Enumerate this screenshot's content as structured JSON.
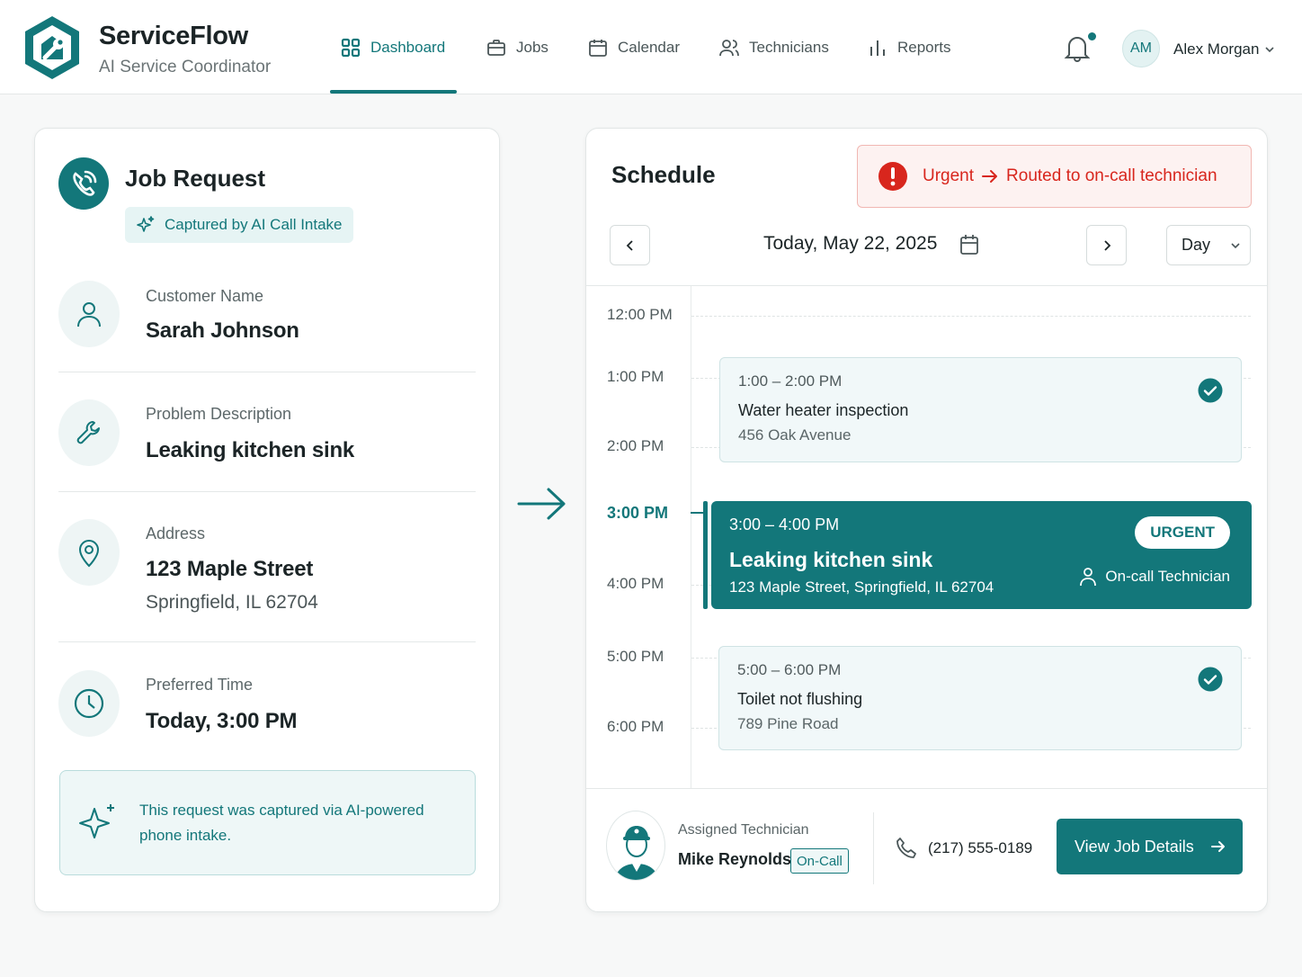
{
  "brand": {
    "name": "ServiceFlow",
    "subtitle": "AI Service Coordinator"
  },
  "nav": [
    {
      "label": "Dashboard",
      "icon": "grid-icon",
      "active": true
    },
    {
      "label": "Jobs",
      "icon": "briefcase-icon"
    },
    {
      "label": "Calendar",
      "icon": "calendar-icon"
    },
    {
      "label": "Technicians",
      "icon": "users-icon"
    },
    {
      "label": "Reports",
      "icon": "bar-chart-icon"
    }
  ],
  "user": {
    "initials": "AM",
    "name": "Alex Morgan"
  },
  "job_request": {
    "title": "Job Request",
    "badge": "Captured by AI Call Intake",
    "fields": [
      {
        "label": "Customer Name",
        "value": "Sarah Johnson",
        "icon": "user-icon"
      },
      {
        "label": "Problem Description",
        "value": "Leaking kitchen sink",
        "icon": "wrench-icon"
      },
      {
        "label": "Address",
        "value": "123 Maple Street",
        "sub": "Springfield, IL 62704",
        "icon": "location-pin-icon"
      },
      {
        "label": "Preferred Time",
        "value": "Today, 3:00 PM",
        "icon": "clock-icon"
      }
    ],
    "ai_note": "This request was captured via AI-powered phone intake."
  },
  "schedule": {
    "title": "Schedule",
    "alert": {
      "level": "Urgent",
      "message": "Routed to on-call technician"
    },
    "date": "Today, May 22, 2025",
    "view": "Day",
    "times": [
      "12:00 PM",
      "1:00 PM",
      "2:00 PM",
      "3:00 PM",
      "4:00 PM",
      "5:00 PM",
      "6:00 PM"
    ],
    "current_time": "3:00 PM",
    "events": [
      {
        "time": "1:00 – 2:00 PM",
        "title": "Water heater inspection",
        "address": "456 Oak Avenue",
        "status": "completed"
      },
      {
        "time": "3:00 – 4:00 PM",
        "title": "Leaking kitchen sink",
        "address": "123 Maple Street, Springfield, IL 62704",
        "badge": "URGENT",
        "assignee": "On-call Technician"
      },
      {
        "time": "5:00 – 6:00 PM",
        "title": "Toilet not flushing",
        "address": "789 Pine Road",
        "status": "completed"
      }
    ],
    "technician": {
      "label": "Assigned Technician",
      "name": "Mike Reynolds",
      "status": "On-Call",
      "phone": "(217) 555-0189"
    },
    "action": "View Job Details"
  },
  "colors": {
    "accent": "#13777a",
    "urgent": "#d8261d",
    "accent_light": "#e6f4f4"
  }
}
